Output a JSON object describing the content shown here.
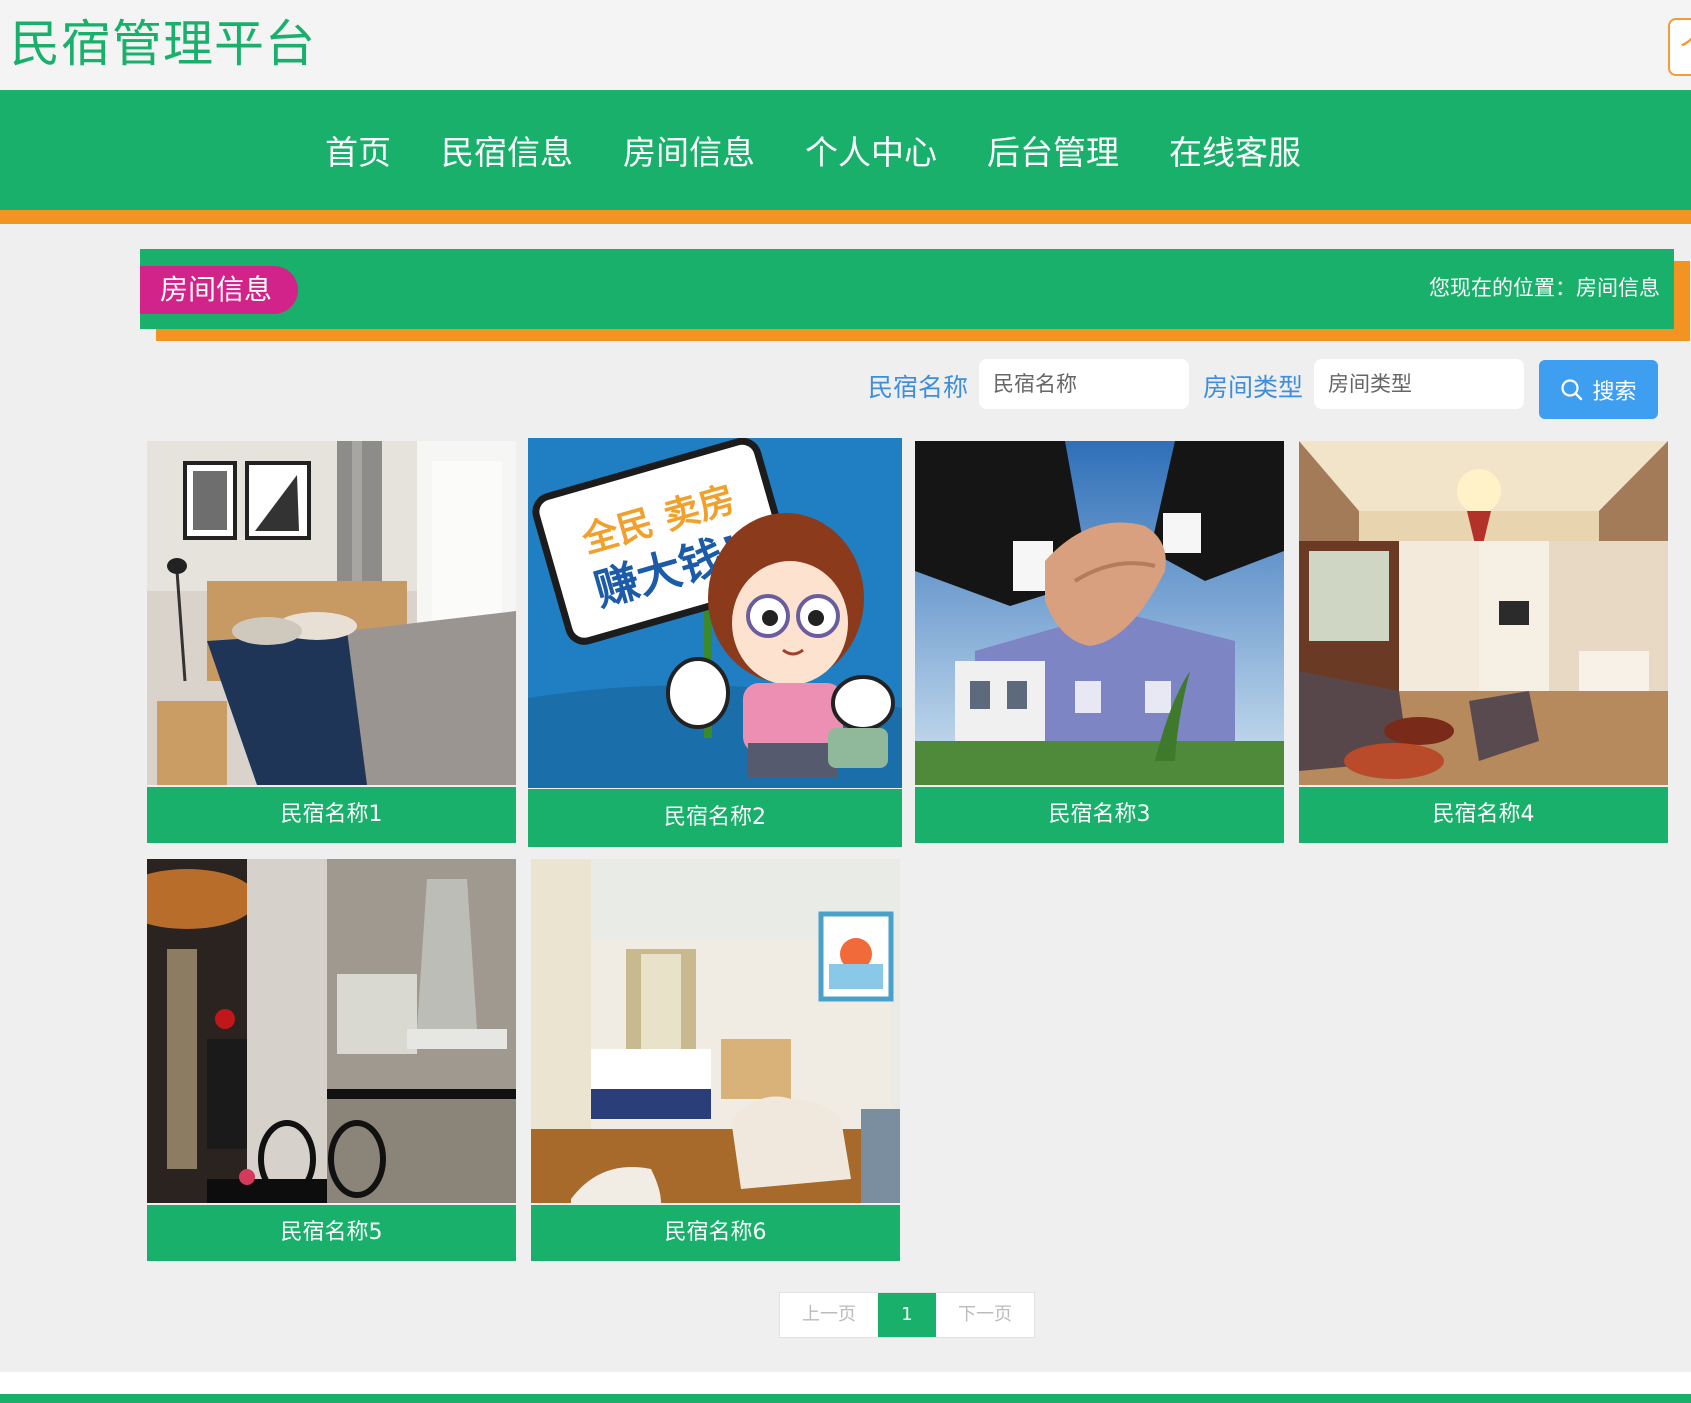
{
  "header": {
    "site_title": "民宿管理平台",
    "corner_button_label": "个"
  },
  "nav": {
    "items": [
      "首页",
      "民宿信息",
      "房间信息",
      "个人中心",
      "后台管理",
      "在线客服"
    ]
  },
  "section": {
    "title": "房间信息",
    "breadcrumb": "您现在的位置：房间信息"
  },
  "search": {
    "field1_label": "民宿名称",
    "field1_placeholder": "民宿名称",
    "field2_label": "房间类型",
    "field2_placeholder": "房间类型",
    "button_label": "搜索"
  },
  "rooms": [
    {
      "name": "民宿名称1"
    },
    {
      "name": "民宿名称2",
      "sign_line1": "全民 卖房",
      "sign_line2": "赚大钱!"
    },
    {
      "name": "民宿名称3"
    },
    {
      "name": "民宿名称4"
    },
    {
      "name": "民宿名称5"
    },
    {
      "name": "民宿名称6"
    }
  ],
  "pagination": {
    "prev": "上一页",
    "current": "1",
    "next": "下一页"
  },
  "colors": {
    "primary_green": "#18b06a",
    "accent_orange": "#f39321",
    "badge_magenta": "#d2238a",
    "search_blue": "#3e9ff0",
    "label_blue": "#3d8edb"
  }
}
